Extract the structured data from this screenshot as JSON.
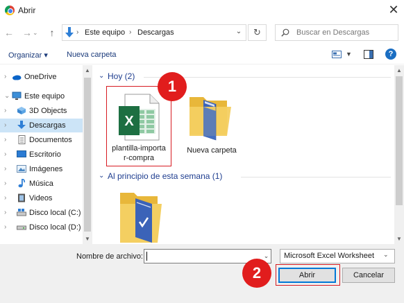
{
  "window": {
    "title": "Abrir",
    "close_glyph": "✕"
  },
  "nav": {
    "back_glyph": "←",
    "forward_glyph": "→",
    "up_glyph": "↑",
    "breadcrumb": [
      "Este equipo",
      "Descargas"
    ],
    "separator": "›",
    "refresh_glyph": "↻",
    "dropdown_glyph": "⌄",
    "search_placeholder": "Buscar en Descargas"
  },
  "toolbar": {
    "organize_label": "Organizar ▾",
    "new_folder_label": "Nueva carpeta",
    "help_glyph": "?"
  },
  "sidebar": {
    "items": [
      {
        "label": "OneDrive",
        "icon": "onedrive-icon"
      },
      {
        "label": "Este equipo",
        "icon": "computer-icon"
      },
      {
        "label": "3D Objects",
        "icon": "3d-objects-icon"
      },
      {
        "label": "Descargas",
        "icon": "download-icon",
        "selected": true
      },
      {
        "label": "Documentos",
        "icon": "document-icon"
      },
      {
        "label": "Escritorio",
        "icon": "desktop-icon"
      },
      {
        "label": "Imágenes",
        "icon": "images-icon"
      },
      {
        "label": "Música",
        "icon": "music-icon"
      },
      {
        "label": "Videos",
        "icon": "video-icon"
      },
      {
        "label": "Disco local (C:)",
        "icon": "drive-icon"
      },
      {
        "label": "Disco local (D:)",
        "icon": "drive-icon"
      }
    ]
  },
  "groups": [
    {
      "header": "Hoy (2)",
      "files": [
        {
          "label_line1": "plantilla-importa",
          "label_line2": "r-compra",
          "icon": "excel-file-icon",
          "highlighted": true
        },
        {
          "label_line1": "Nueva carpeta",
          "label_line2": "",
          "icon": "folder-icon"
        }
      ]
    },
    {
      "header": "Al principio de esta semana (1)",
      "files": [
        {
          "label_line1": "",
          "label_line2": "",
          "icon": "folder-icon"
        }
      ]
    }
  ],
  "footer": {
    "filename_label": "Nombre de archivo:",
    "filename_value": "",
    "filetype_value": "Microsoft Excel Worksheet",
    "open_label": "Abrir",
    "cancel_label": "Cancelar"
  },
  "badges": {
    "step1": "1",
    "step2": "2"
  },
  "colors": {
    "accent": "#0078d7",
    "highlight_red": "#d71a21",
    "badge_red": "#e11d1d",
    "selected_bg": "#cce4f7",
    "excel_green": "#1d6f42"
  }
}
